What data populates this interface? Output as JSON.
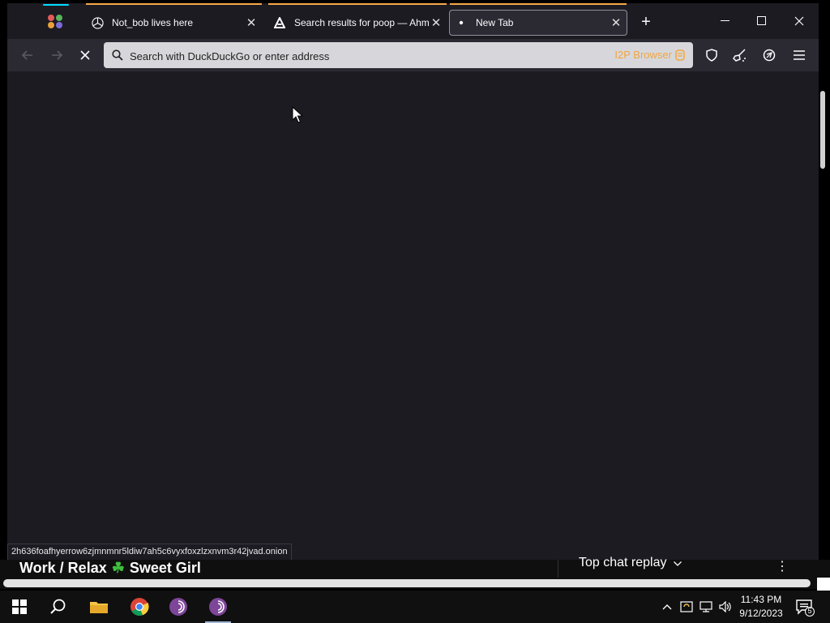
{
  "tabs": [
    {
      "title": "Not_bob lives here",
      "icon": "mercedes-logo-icon"
    },
    {
      "title": "Search results for poop — Ahmia",
      "icon": "ahmia-logo-icon"
    },
    {
      "title": "New Tab",
      "icon": "dot-icon"
    }
  ],
  "window_controls": {
    "minimize": "—",
    "maximize": "☐",
    "close": "✕"
  },
  "urlbar": {
    "placeholder": "Search with DuckDuckGo or enter address",
    "badge": "I2P Browser"
  },
  "status_url": "2h636foafhyerrow6zjmnmnr5ldiw7ah5c6vyxfoxzlzxnvm3r42jvad.onion",
  "background_window": {
    "video_title_left": "Work / Relax",
    "clover": "☘",
    "video_title_right": "Sweet Girl",
    "chat_label": "Top chat replay"
  },
  "taskbar": {
    "apps": [
      "windows-start",
      "search",
      "file-explorer",
      "chrome",
      "tor-browser",
      "tor-browser-active"
    ],
    "time": "11:43 PM",
    "date": "9/12/2023",
    "notifications": "5"
  },
  "colors": {
    "accent": "#f7a84a",
    "loading_pill": "#00ddff",
    "i2p_badge": "#f2a53d"
  }
}
